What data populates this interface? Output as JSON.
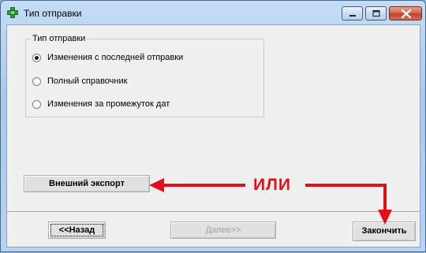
{
  "window": {
    "title": "Тип отправки"
  },
  "group": {
    "legend": "Тип отправки",
    "options": [
      {
        "label": "Изменения с последней отправки",
        "selected": true
      },
      {
        "label": "Полный справочник",
        "selected": false
      },
      {
        "label": "Изменения за промежуток дат",
        "selected": false
      }
    ]
  },
  "buttons": {
    "external_export": "Внешний экспорт",
    "back": "<<Назад",
    "next": "Далее>>",
    "finish": "Закончить"
  },
  "annotation": {
    "text": "ИЛИ",
    "color": "#e0101a"
  },
  "icons": [
    "app-cross-icon",
    "minimize-icon",
    "maximize-icon",
    "close-icon",
    "radio-selected-icon"
  ]
}
